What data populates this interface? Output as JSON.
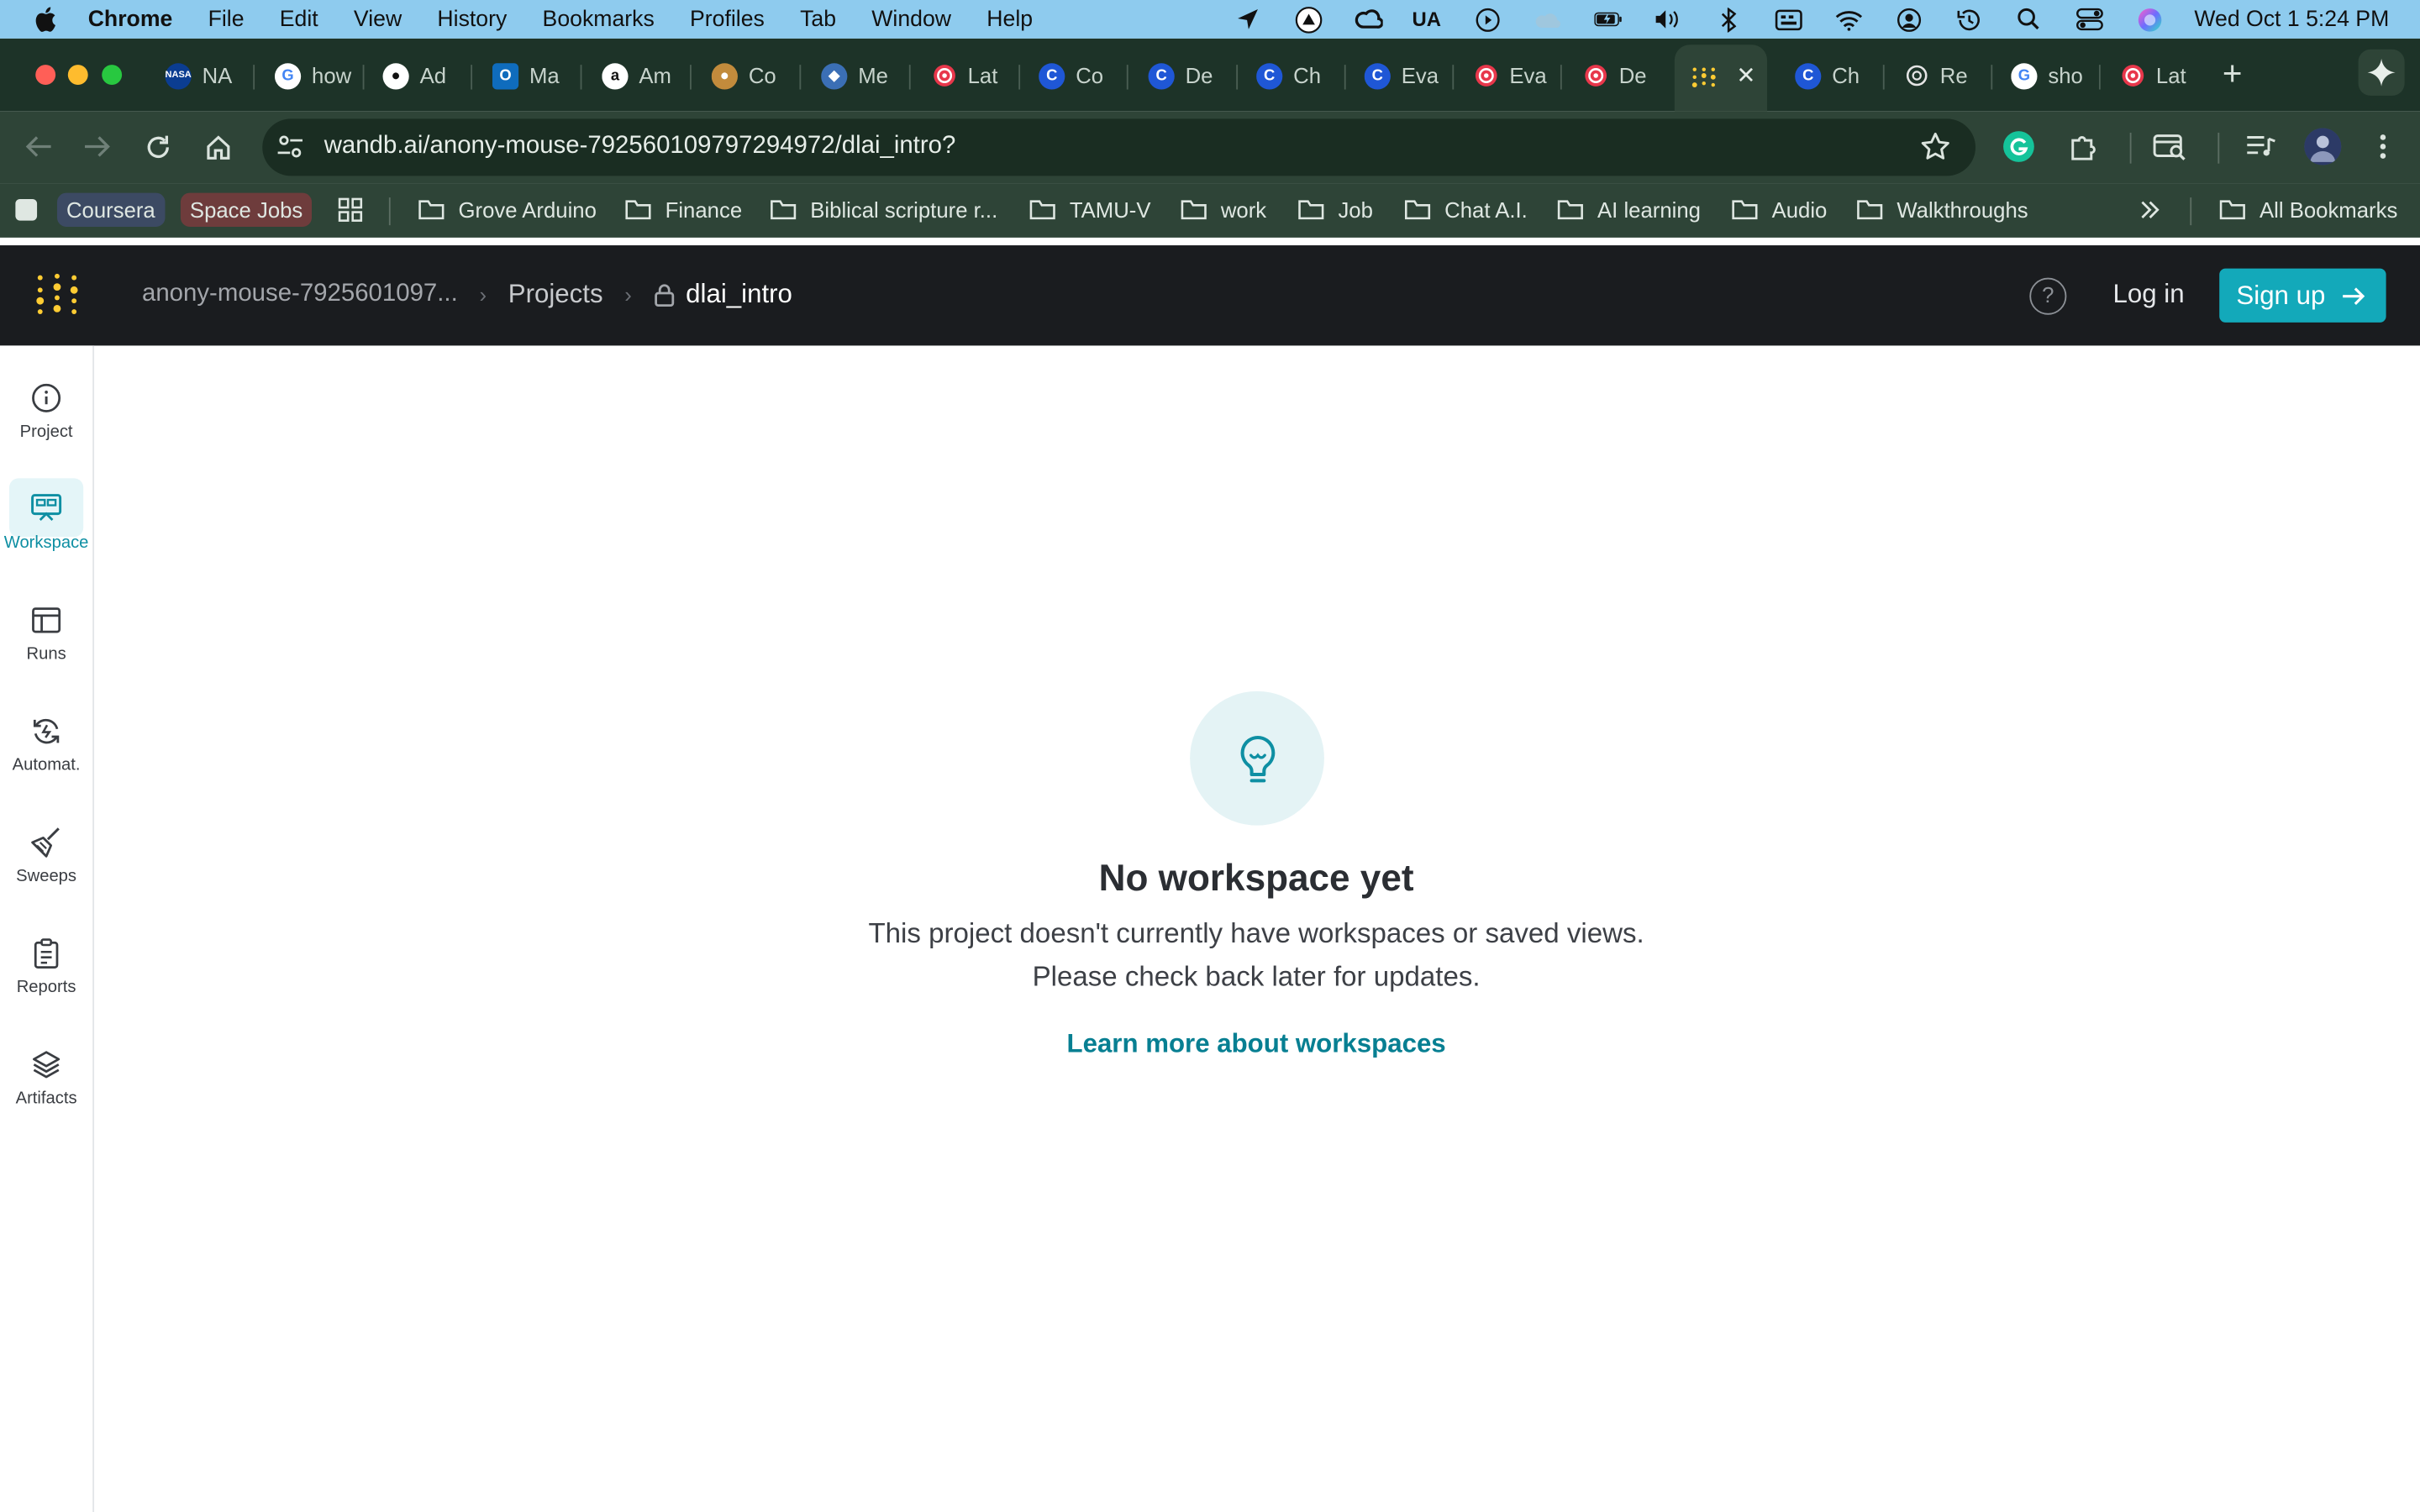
{
  "menubar": {
    "app_name": "Chrome",
    "items": [
      "File",
      "Edit",
      "View",
      "History",
      "Bookmarks",
      "Profiles",
      "Tab",
      "Window",
      "Help"
    ],
    "ua_label": "UA",
    "clock": "Wed Oct 1  5:24 PM"
  },
  "tabs": [
    {
      "label": "NA",
      "icon": "nasa-icon",
      "color": "#0b3d91"
    },
    {
      "label": "how",
      "icon": "google-icon",
      "color": "#ffffff"
    },
    {
      "label": "Ad",
      "icon": "github-icon",
      "color": "#ffffff"
    },
    {
      "label": "Ma",
      "icon": "outlook-icon",
      "color": "#0f6cbd"
    },
    {
      "label": "Am",
      "icon": "amazon-icon",
      "color": "#ffffff"
    },
    {
      "label": "Co",
      "icon": "coursera-lion-icon",
      "color": "#c28b3c"
    },
    {
      "label": "Me",
      "icon": "shield-icon",
      "color": "#3b6fb5"
    },
    {
      "label": "Lat",
      "icon": "target-icon",
      "color": "#e8374b"
    },
    {
      "label": "Co",
      "icon": "coursera-icon",
      "color": "#1f57d6"
    },
    {
      "label": "De",
      "icon": "coursera-icon",
      "color": "#1f57d6"
    },
    {
      "label": "Ch",
      "icon": "coursera-icon",
      "color": "#1f57d6"
    },
    {
      "label": "Eva",
      "icon": "coursera-icon",
      "color": "#1f57d6"
    },
    {
      "label": "Eva",
      "icon": "target-icon",
      "color": "#e8374b"
    },
    {
      "label": "De",
      "icon": "target-icon",
      "color": "#e8374b"
    },
    {
      "label": "",
      "icon": "wandb-icon",
      "color": "#ffcc33",
      "active": true
    },
    {
      "label": "Ch",
      "icon": "coursera-icon",
      "color": "#1f57d6"
    },
    {
      "label": "Re",
      "icon": "openai-icon",
      "color": "#ffffff"
    },
    {
      "label": "sho",
      "icon": "google-icon",
      "color": "#ffffff"
    },
    {
      "label": "Lat",
      "icon": "target-icon",
      "color": "#e8374b"
    }
  ],
  "toolbar": {
    "url": "wandb.ai/anony-mouse-792560109797294972/dlai_intro?"
  },
  "bookmarks": {
    "pills": [
      {
        "label": "Coursera",
        "bg": "#3c4a63"
      },
      {
        "label": "Space Jobs",
        "bg": "#6e3c3c"
      }
    ],
    "folders": [
      "Grove Arduino",
      "Finance",
      "Biblical scripture r...",
      "TAMU-V",
      "work",
      "Job",
      "Chat A.I.",
      "AI learning",
      "Audio",
      "Walkthroughs"
    ],
    "all_bookmarks": "All Bookmarks"
  },
  "header": {
    "entity": "anony-mouse-7925601097...",
    "projects": "Projects",
    "project": "dlai_intro",
    "help": "?",
    "login": "Log in",
    "signup": "Sign up",
    "accent": "#13a9ba"
  },
  "nav": {
    "items": [
      {
        "label": "Project",
        "icon": "info-icon"
      },
      {
        "label": "Workspace",
        "icon": "workspace-icon",
        "selected": true
      },
      {
        "label": "Runs",
        "icon": "table-icon"
      },
      {
        "label": "Automat.",
        "icon": "automation-icon"
      },
      {
        "label": "Sweeps",
        "icon": "broom-icon"
      },
      {
        "label": "Reports",
        "icon": "clipboard-icon"
      },
      {
        "label": "Artifacts",
        "icon": "layers-icon"
      }
    ]
  },
  "empty_state": {
    "icon": "lightbulb-icon",
    "title": "No workspace yet",
    "line1": "This project doesn't currently have workspaces or saved views.",
    "line2": "Please check back later for updates.",
    "link": "Learn more about workspaces"
  }
}
